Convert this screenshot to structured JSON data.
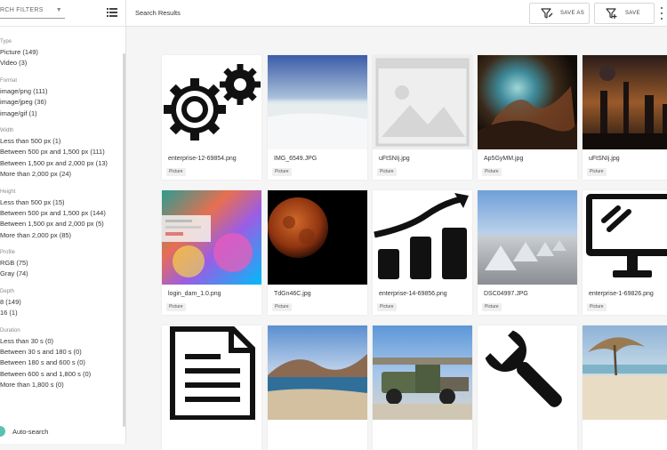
{
  "sidebar": {
    "select_label": "RCH FILTERS",
    "facets": [
      {
        "title": "Type",
        "items": [
          "Picture (149)",
          "Video (3)"
        ]
      },
      {
        "title": "Format",
        "items": [
          "image/png (111)",
          "image/jpeg (36)",
          "image/gif (1)"
        ]
      },
      {
        "title": "Width",
        "items": [
          "Less than 500 px (1)",
          "Between 500 px and 1,500 px (111)",
          "Between 1,500 px and 2,000 px (13)",
          "More than 2,000 px (24)"
        ]
      },
      {
        "title": "Height",
        "items": [
          "Less than 500 px (15)",
          "Between 500 px and 1,500 px (144)",
          "Between 1,500 px and 2,000 px (5)",
          "More than 2,000 px (85)"
        ]
      },
      {
        "title": "Profile",
        "items": [
          "RGB (75)",
          "Gray (74)"
        ]
      },
      {
        "title": "Depth",
        "items": [
          "8 (149)",
          "16 (1)"
        ]
      },
      {
        "title": "Duration",
        "items": [
          "Less than 30 s (0)",
          "Between 30 s and 180 s (0)",
          "Between 180 s and 600 s (0)",
          "Between 600 s and 1,800 s (0)",
          "More than 1,800 s (0)"
        ]
      }
    ],
    "autosearch_label": "Auto-search"
  },
  "topbar": {
    "title": "Search Results",
    "save_as_label": "SAVE AS",
    "save_label": "SAVE"
  },
  "results": [
    {
      "filename": "enterprise-12-69854.png",
      "type": "Picture",
      "thumb": "gears-icon"
    },
    {
      "filename": "IMG_6549.JPG",
      "type": "Picture",
      "thumb": "salt-flat-photo"
    },
    {
      "filename": "uFtSNIj.jpg",
      "type": "Picture",
      "thumb": "image-placeholder-icon"
    },
    {
      "filename": "Ap5GyMM.jpg",
      "type": "Picture",
      "thumb": "nebula-photo"
    },
    {
      "filename": "uFtSNIj.jpg",
      "type": "Picture",
      "thumb": "scifi-city-photo"
    },
    {
      "filename": "login_dam_1.0.png",
      "type": "Picture",
      "thumb": "colorful-screenshot"
    },
    {
      "filename": "TdGn46C.jpg",
      "type": "Picture",
      "thumb": "red-moon-photo"
    },
    {
      "filename": "enterprise-14-69856.png",
      "type": "Picture",
      "thumb": "growth-chart-icon"
    },
    {
      "filename": "DSC04997.JPG",
      "type": "Picture",
      "thumb": "salt-mounds-photo"
    },
    {
      "filename": "enterprise-1-69826.png",
      "type": "Picture",
      "thumb": "monitor-icon"
    },
    {
      "filename": "",
      "type": "",
      "thumb": "document-icon"
    },
    {
      "filename": "",
      "type": "",
      "thumb": "lagoon-photo"
    },
    {
      "filename": "",
      "type": "",
      "thumb": "old-truck-photo"
    },
    {
      "filename": "",
      "type": "",
      "thumb": "wrench-icon"
    },
    {
      "filename": "",
      "type": "",
      "thumb": "beach-umbrella-photo"
    }
  ],
  "colors": {
    "accent": "#5bc0b0"
  }
}
